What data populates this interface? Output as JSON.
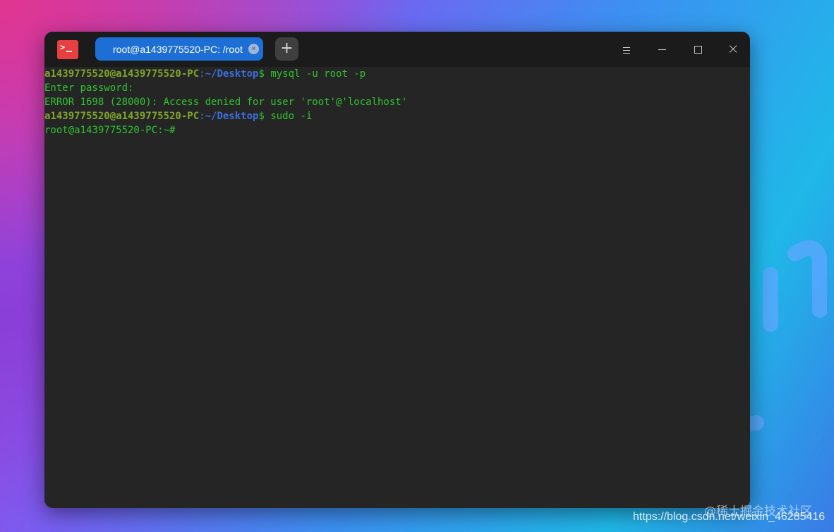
{
  "window": {
    "tab_title": "root@a1439775520-PC: /root",
    "tab_close": "×",
    "new_tab": "+",
    "app_icon": "terminal-icon"
  },
  "terminal": {
    "lines": [
      {
        "user": "a1439775520@a1439775520-PC",
        "colon": ":",
        "path": "~/Desktop",
        "dollar": "$",
        "cmd": " mysql -u root -p"
      },
      {
        "text": "Enter password:"
      },
      {
        "text": "ERROR 1698 (28000): Access denied for user 'root'@'localhost'"
      },
      {
        "user": "a1439775520@a1439775520-PC",
        "colon": ":",
        "path": "~/Desktop",
        "dollar": "$",
        "cmd": " sudo -i"
      },
      {
        "text": "root@a1439775520-PC:~#"
      }
    ]
  },
  "watermark": {
    "site": "@稀土掘金技术社区",
    "url": "https://blog.csdn.net/weixin_46285416"
  },
  "colors": {
    "tab_active": "#1d6fd6",
    "terminal_bg": "#252525",
    "text_green": "#2fc42f",
    "user_olive": "#80a62b",
    "path_blue": "#3a6fe0"
  }
}
